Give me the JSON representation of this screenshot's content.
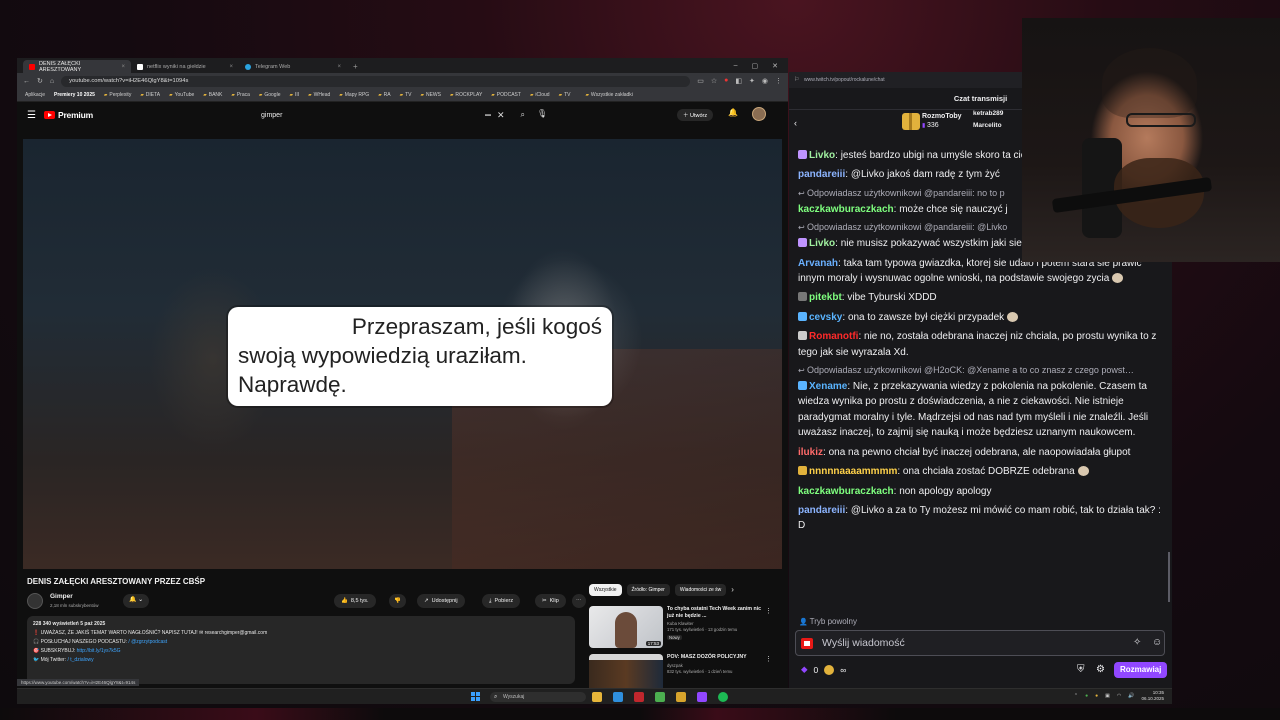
{
  "browser": {
    "tabs": [
      {
        "title": "DENIS ZAŁĘCKI ARESZTOWANY",
        "fav": "#ff0000",
        "active": true
      },
      {
        "title": "netflix wyniki na giełdzie",
        "fav": "#ffffff",
        "active": false
      },
      {
        "title": "Telegram Web",
        "fav": "#2aa3df",
        "active": false
      }
    ],
    "url": "youtube.com/watch?v=iH2E46QlgY8&t=1094s",
    "bookmarks": [
      "Aplikacje",
      "Premiery 10 2025",
      "Perplexity",
      "DIETA",
      "YouTube",
      "BANK",
      "Praca",
      "Google",
      "III",
      "WHead",
      "Mapy RPG",
      "RA",
      "TV",
      "NEWS",
      "ROCKPLAY",
      "PODCAST",
      "iCloud",
      "TV",
      "Wszystkie zakładki"
    ]
  },
  "youtube": {
    "logo": "Premium",
    "search_value": "gimper",
    "create_label": "Utwórz",
    "subtitle_lines": [
      "Przepraszam, jeśli kogoś",
      "swoją wypowiedzią uraziłam.",
      "Naprawdę."
    ],
    "video_title": "DENIS ZAŁĘCKI ARESZTOWANY PRZEZ CBŚP",
    "channel_name": "Gimper",
    "channel_subs": "2,18 mln subskrybentów",
    "actions": {
      "likes": "8,5 tys.",
      "share": "Udostępnij",
      "download": "Pobierz",
      "clip": "Klip"
    },
    "description": {
      "meta": "228 340 wyświetleń  5 paź 2025",
      "l1_text": "❗ UWAŻASZ, ŻE JAKIŚ TEMAT WARTO NAGŁOŚNIĆ? NAPISZ TUTAJ! ✉ ",
      "l1_email": "researchgimper@gmail.com",
      "l3_text": "🎧 POSŁUCHAJ NASZEGO PODCASTU: ",
      "l3_link": "/ @zgrzytpodcast",
      "l4_text": "🎯 SUBSKRYBUJ: ",
      "l4_link": "http://bit.ly/1ys7k5G",
      "l5_text": "🐦 Mój Twitter: ",
      "l5_link": "/ t_dzialowy"
    },
    "status_url": "https://www.youtube.com/watch?v=iH2E46QlgY8&t=914s",
    "chips": [
      "Wszystkie",
      "Źródło: Gimper",
      "Wiadomości ze św"
    ],
    "recommendations": [
      {
        "title": "To chyba ostatni Tech Week zanim nic już nie będzie ...",
        "channel": "Kuba Klawiter",
        "views": "171 tys. wyświetleń · 13 godzin temu",
        "badge": "Nowy",
        "duration": "17:53"
      },
      {
        "title": "POV: MASZ DOZÓR POLICYJNY",
        "channel": "dyszpak",
        "views": "832 tys. wyświetleń · 1 dzień temu",
        "badge": "",
        "duration": ""
      }
    ]
  },
  "taskbar": {
    "search_placeholder": "Wyszukaj",
    "time": "10:35",
    "date": "06.10.2025"
  },
  "chat": {
    "url": "www.twitch.tv/popout/rockalune/chat",
    "title": "Czat transmisji",
    "gift": {
      "user": "RozmoToby",
      "count": "336",
      "others": [
        "ketrab289",
        "Marcelito"
      ]
    },
    "messages": [
      {
        "type": "msg",
        "user": "Livko",
        "color": "#a0f0a0",
        "badge": "#bf94ff",
        "text": "jesteś bardzo ubigi na umyśle skoro ta ciebie nie żal."
      },
      {
        "type": "msg",
        "user": "pandareiii",
        "color": "#8cb4ff",
        "badge": "",
        "text": "@Livko jakoś dam radę z tym żyć"
      },
      {
        "type": "reply",
        "text": "Odpowiadasz użytkownikowi @pandareiii: no to p"
      },
      {
        "type": "msg",
        "user": "kaczkawburaczkach",
        "color": "#7fff7f",
        "badge": "",
        "text": "może chce się nauczyć j"
      },
      {
        "type": "reply",
        "text": "Odpowiadasz użytkownikowi @pandareiii: @Livko"
      },
      {
        "type": "msg",
        "user": "Livko",
        "color": "#a0f0a0",
        "badge": "#bf94ff",
        "text": "nie musisz pokazywać wszystkim jaki siebie"
      },
      {
        "type": "msg",
        "user": "Arvanah",
        "color": "#6ab0ff",
        "badge": "",
        "text": "taka tam typowa gwiazdka, ktorej sie udalo i potem stara sie prawic innym moraly i wysnuwac ogolne wnioski, na podstawie swojego zycia",
        "emote": true
      },
      {
        "type": "msg",
        "user": "pitekbt",
        "color": "#7fff7f",
        "badge": "#777777",
        "text": "vibe Tyburski XDDD"
      },
      {
        "type": "msg",
        "user": "cevsky",
        "color": "#5ab4ff",
        "badge": "#5ab4ff",
        "text": "ona to zawsze był ciężki przypadek",
        "emote": true
      },
      {
        "type": "msg",
        "user": "Romanotfi",
        "color": "#ff2a2a",
        "badge": "#cccccc",
        "text": "nie no, została odebrana inaczej niz chciala, po prostu wynika to z tego jak sie wyrazala Xd."
      },
      {
        "type": "reply",
        "text": "Odpowiadasz użytkownikowi @H2oCK: @Xename a to co znasz z czego powst…"
      },
      {
        "type": "msg",
        "user": "Xename",
        "color": "#5ab4ff",
        "badge": "#5ab4ff",
        "text": "Nie, z przekazywania wiedzy z pokolenia na pokolenie. Czasem ta wiedza wynika po prostu z doświadczenia, a nie z ciekawości. Nie istnieje paradygmat moralny i tyle. Mądrzejsi od nas nad tym myśleli i nie znaleźli. Jeśli uważasz inaczej, to zajmij się nauką i może będziesz uznanym naukowcem."
      },
      {
        "type": "msg",
        "user": "ilukiz",
        "color": "#ff6a6a",
        "badge": "",
        "text": "ona na pewno chciał być inaczej odebrana, ale naopowiadała głupot"
      },
      {
        "type": "msg",
        "user": "nnnnnaaaammmm",
        "color": "#ffd24a",
        "badge": "#e2b23c",
        "text": "ona chciała zostać DOBRZE odebrana",
        "emote": true
      },
      {
        "type": "msg",
        "user": "kaczkawburaczkach",
        "color": "#7fff7f",
        "badge": "",
        "text": "non apology apology"
      },
      {
        "type": "msg",
        "user": "pandareiii",
        "color": "#8cb4ff",
        "badge": "",
        "text": "@Livko a za to Ty możesz mi mówić co mam robić, tak to działa tak? : D"
      }
    ],
    "mode_label": "Tryb powolny",
    "input_placeholder": "Wyślij wiadomość",
    "points": "0",
    "points2": "∞",
    "send_label": "Rozmawiaj"
  },
  "colors": {
    "accent": "#9147ff",
    "yt_red": "#ff0000",
    "chat_bg": "#18181b"
  }
}
